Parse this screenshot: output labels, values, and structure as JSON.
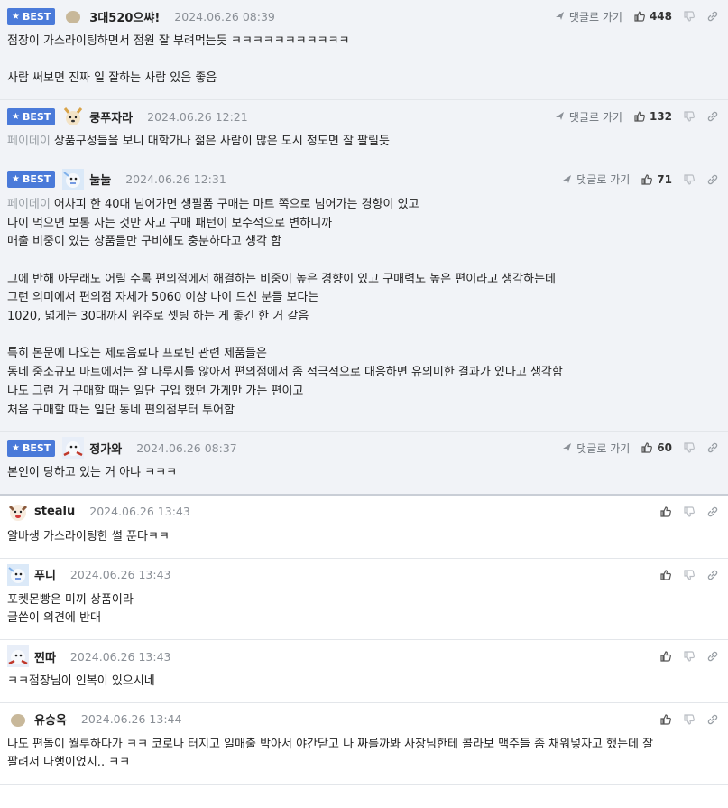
{
  "comments": [
    {
      "best": true,
      "badge": "BEST",
      "nick": "3대520으쌰!",
      "date": "2024.06.26 08:39",
      "reply_label": "댓글로 가기",
      "likes": "448",
      "avatar": "beige-dot",
      "quote": "",
      "lines": [
        "점장이 가스라이팅하면서 점원 잘 부려먹는듯 ㅋㅋㅋㅋㅋㅋㅋㅋㅋㅋㅋ",
        "",
        "사람 써보면 진짜 일 잘하는 사람 있음 좋음"
      ]
    },
    {
      "best": true,
      "badge": "BEST",
      "nick": "쿵푸자라",
      "date": "2024.06.26 12:21",
      "reply_label": "댓글로 가기",
      "likes": "132",
      "avatar": "dog",
      "quote": "페이데이",
      "lines": [
        "상품구성들을 보니 대학가나 젊은 사람이 많은 도시 정도면 잘 팔릴듯"
      ]
    },
    {
      "best": true,
      "badge": "BEST",
      "nick": "눌눌",
      "date": "2024.06.26 12:31",
      "reply_label": "댓글로 가기",
      "likes": "71",
      "avatar": "blue-bird",
      "quote": "페이데이",
      "lines": [
        "어차피 한 40대 넘어가면 생필품 구매는 마트 쪽으로 넘어가는 경향이 있고",
        "나이 먹으면 보통 사는 것만 사고 구매 패턴이 보수적으로 변하니까",
        "매출 비중이 있는 상품들만 구비해도 충분하다고 생각 함",
        "",
        "그에 반해 아무래도 어릴 수록 편의점에서 해결하는 비중이 높은 경향이 있고 구매력도 높은 편이라고 생각하는데",
        "그런 의미에서 편의점 자체가 5060 이상 나이 드신 분들 보다는",
        "1020, 넓게는 30대까지 위주로 셋팅 하는 게 좋긴 한 거 같음",
        "",
        "특히 본문에 나오는 제로음료나 프로틴 관련 제품들은",
        "동네 중소규모 마트에서는 잘 다루지를 않아서 편의점에서 좀 적극적으로 대응하면 유의미한 결과가 있다고 생각함",
        "나도 그런 거 구매할 때는 일단 구입 했던 가게만 가는 편이고",
        "처음 구매할 때는 일단 동네 편의점부터 투어함"
      ]
    },
    {
      "best": true,
      "badge": "BEST",
      "nick": "정가와",
      "date": "2024.06.26 08:37",
      "reply_label": "댓글로 가기",
      "likes": "60",
      "avatar": "red-bird",
      "quote": "",
      "lines": [
        "본인이 당하고 있는 거 아냐 ㅋㅋㅋ"
      ]
    },
    {
      "best": false,
      "nick": "stealu",
      "date": "2024.06.26 13:43",
      "avatar": "red-dog",
      "quote": "",
      "lines": [
        "알바생 가스라이팅한 썰 푼다ㅋㅋ"
      ]
    },
    {
      "best": false,
      "nick": "푸니",
      "date": "2024.06.26 13:43",
      "avatar": "blue-bird",
      "quote": "",
      "lines": [
        "포켓몬빵은 미끼 상품이라",
        "글쓴이 의견에 반대"
      ]
    },
    {
      "best": false,
      "nick": "찐따",
      "date": "2024.06.26 13:43",
      "avatar": "red-bird",
      "quote": "",
      "lines": [
        "ㅋㅋ점장님이 인복이 있으시네"
      ]
    },
    {
      "best": false,
      "nick": "유승옥",
      "date": "2024.06.26 13:44",
      "avatar": "beige-dot",
      "quote": "",
      "lines": [
        "나도 편돌이 월루하다가 ㅋㅋ 코로나 터지고 일매출 박아서 야간닫고 나 짜를까봐 사장님한테 콜라보 맥주들 좀 채워넣자고 했는데 잘",
        "팔려서 다행이었지.. ㅋㅋ"
      ]
    }
  ],
  "colors": {
    "best_bg": "#f1f3f7",
    "badge": "#4a7ad9",
    "divider": "#e3e6ea"
  }
}
